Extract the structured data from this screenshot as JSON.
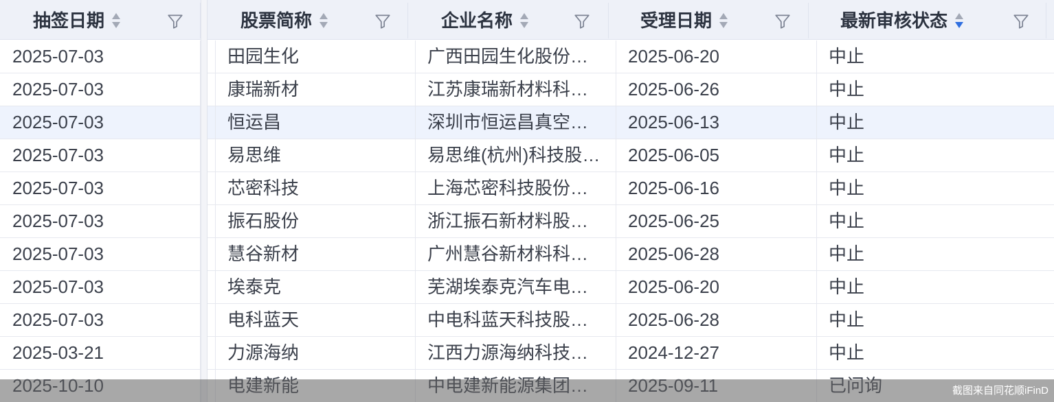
{
  "columns": [
    {
      "label": "抽签日期",
      "sort": "none"
    },
    {
      "label": "股票简称",
      "sort": "none"
    },
    {
      "label": "企业名称",
      "sort": "none"
    },
    {
      "label": "受理日期",
      "sort": "none"
    },
    {
      "label": "最新审核状态",
      "sort": "desc"
    }
  ],
  "rows": [
    [
      "2025-07-03",
      "田园生化",
      "广西田园生化股份有限公司",
      "2025-06-20",
      "中止"
    ],
    [
      "2025-07-03",
      "康瑞新材",
      "江苏康瑞新材料科技股份有限公司",
      "2025-06-26",
      "中止"
    ],
    [
      "2025-07-03",
      "恒运昌",
      "深圳市恒运昌真空技术股份有限公司",
      "2025-06-13",
      "中止"
    ],
    [
      "2025-07-03",
      "易思维",
      "易思维(杭州)科技股份有限公司",
      "2025-06-05",
      "中止"
    ],
    [
      "2025-07-03",
      "芯密科技",
      "上海芯密科技股份有限公司",
      "2025-06-16",
      "中止"
    ],
    [
      "2025-07-03",
      "振石股份",
      "浙江振石新材料股份有限公司",
      "2025-06-25",
      "中止"
    ],
    [
      "2025-07-03",
      "慧谷新材",
      "广州慧谷新材料科技股份有限公司",
      "2025-06-28",
      "中止"
    ],
    [
      "2025-07-03",
      "埃泰克",
      "芜湖埃泰克汽车电子股份有限公司",
      "2025-06-20",
      "中止"
    ],
    [
      "2025-07-03",
      "电科蓝天",
      "中电科蓝天科技股份有限公司",
      "2025-06-28",
      "中止"
    ],
    [
      "2025-03-21",
      "力源海纳",
      "江西力源海纳科技股份有限公司",
      "2024-12-27",
      "中止"
    ],
    [
      "2025-10-10",
      "电建新能",
      "中电建新能源集团股份有限公司",
      "2025-09-11",
      "已问询"
    ]
  ],
  "highlighted_row": 2,
  "watermark": "截图来自同花顺iFinD",
  "colors": {
    "header_bg": "#eef1f8",
    "sort_active": "#2f6fe0",
    "row_highlight": "#eef3fd"
  }
}
